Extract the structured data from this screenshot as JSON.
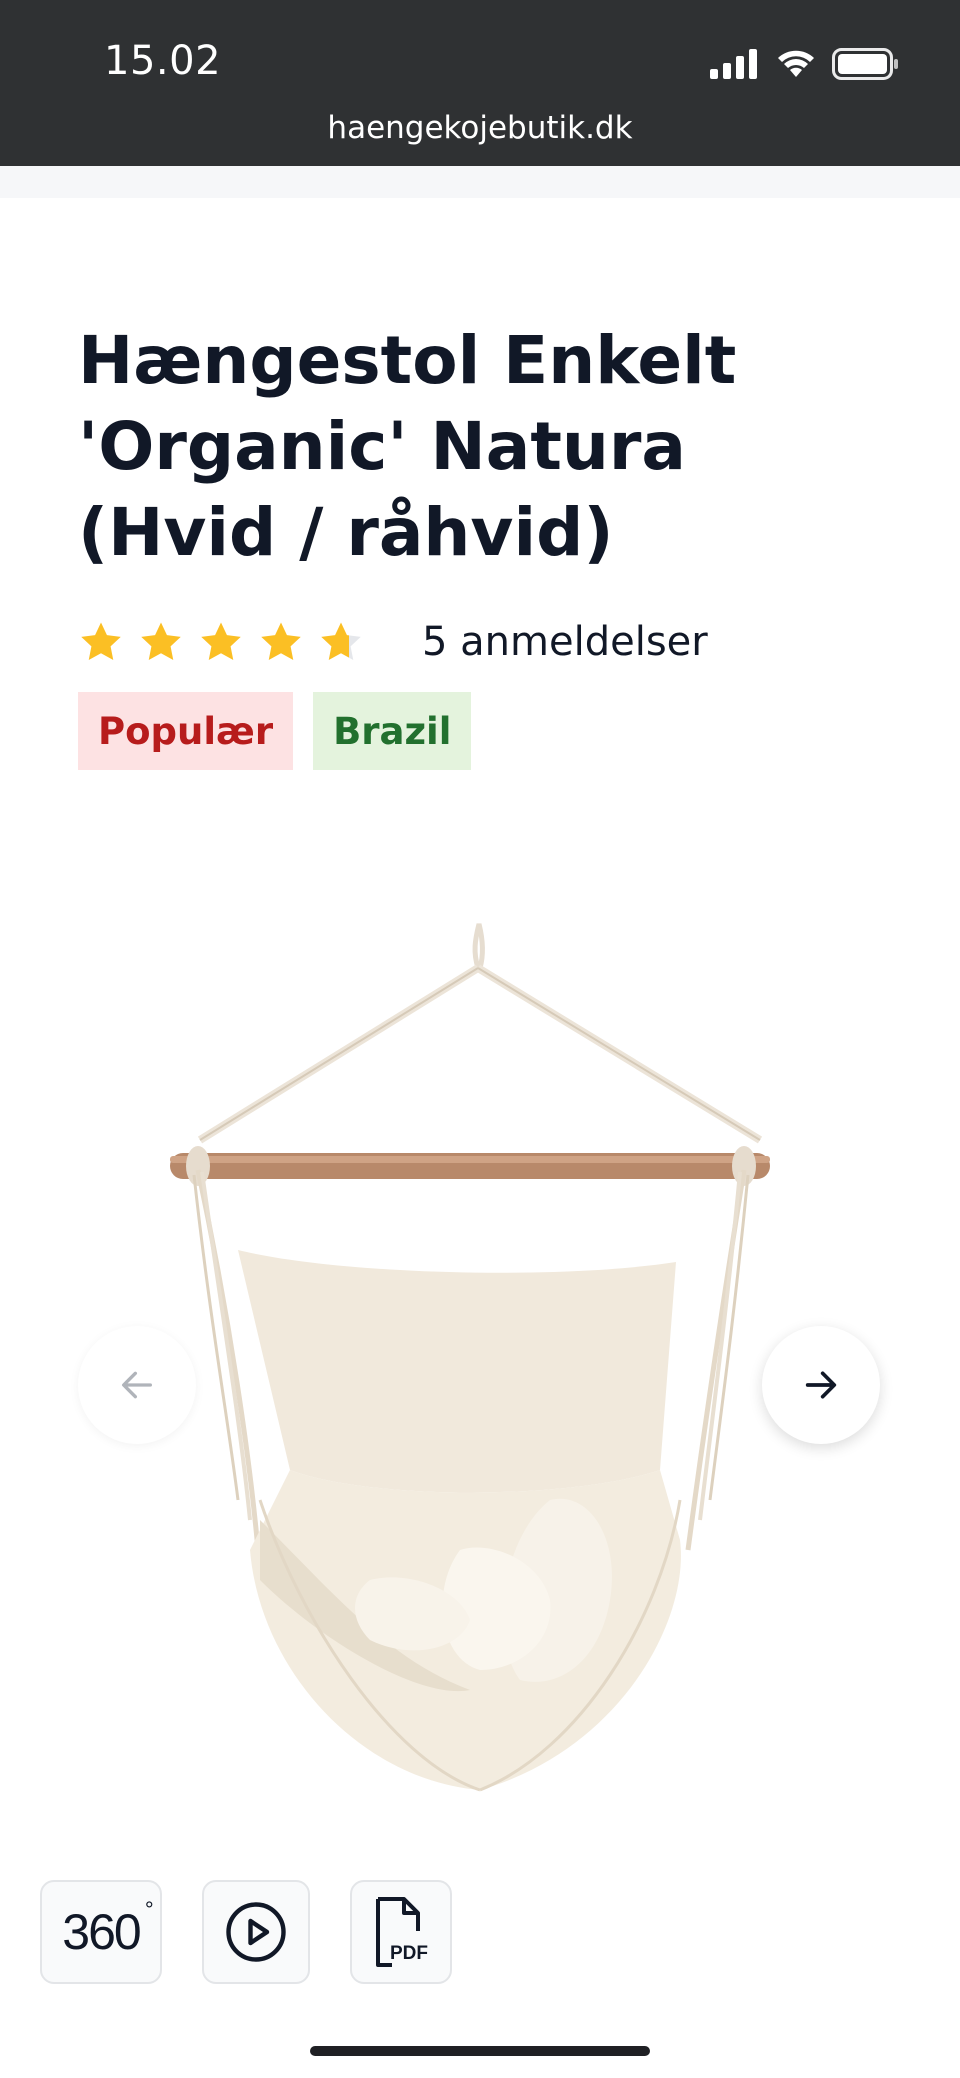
{
  "status_bar": {
    "time": "15.02",
    "signal_icon": "cellular-signal-icon",
    "wifi_icon": "wifi-icon",
    "battery_icon": "battery-icon"
  },
  "browser": {
    "url": "haengekojebutik.dk"
  },
  "product": {
    "title": "Hængestol Enkelt 'Organic' Natura (Hvid / råhvid)",
    "rating": 4.6,
    "rating_max": 5,
    "reviews_label": "5 anmeldelser",
    "badges": [
      {
        "label": "Populær",
        "color": "#b71c1c",
        "background": "#fde2e3"
      },
      {
        "label": "Brazil",
        "color": "#22702e",
        "background": "#e4f3dd"
      }
    ]
  },
  "carousel": {
    "prev_icon": "arrow-left-icon",
    "next_icon": "arrow-right-icon"
  },
  "media": {
    "view_360_label": "360",
    "video_icon": "play-icon",
    "pdf_label": "PDF"
  },
  "colors": {
    "status_bar": "#2f3133",
    "star": "#fbbf24",
    "text": "#111827"
  }
}
